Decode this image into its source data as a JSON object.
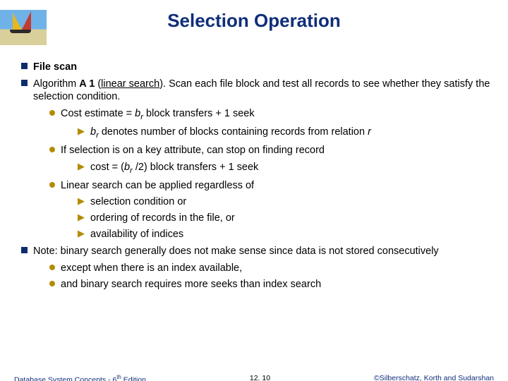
{
  "title": "Selection Operation",
  "bullets": {
    "b1": "File scan",
    "b2a": "Algorithm ",
    "b2b": "A 1",
    "b2c": " (",
    "b2d": "linear search",
    "b2e": ").  Scan each file block and test all records to see whether they satisfy the selection condition.",
    "b2_1a": "Cost estimate = ",
    "b2_1b": "b",
    "b2_1c": "r",
    "b2_1d": " block transfers + 1 seek",
    "b2_1_1a": "b",
    "b2_1_1b": "r",
    "b2_1_1c": "  denotes number of blocks containing records from relation ",
    "b2_1_1d": "r",
    "b2_2": "If selection is on a key attribute, can stop on finding record",
    "b2_2_1a": "cost = (",
    "b2_2_1b": "b",
    "b2_2_1c": "r",
    "b2_2_1d": " /2) block transfers + 1 seek",
    "b2_3": "Linear search can be applied regardless of",
    "b2_3_1": "selection condition or",
    "b2_3_2": "ordering of records in the file, or",
    "b2_3_3": "availability of indices",
    "b3": "Note: binary search generally does not make sense since data is not stored consecutively",
    "b3_1": "except when there is an index available,",
    "b3_2": "and binary search requires more seeks than index search"
  },
  "footer": {
    "left_a": "Database System Concepts - 6",
    "left_b": "th",
    "left_c": " Edition",
    "center": "12. 10",
    "right": "©Silberschatz, Korth and Sudarshan"
  }
}
